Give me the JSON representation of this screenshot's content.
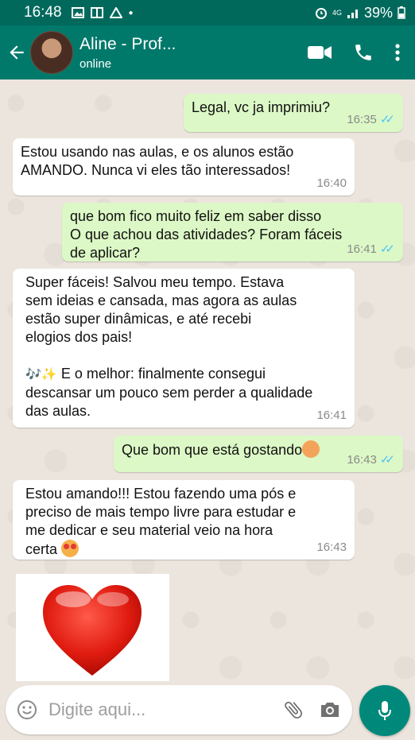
{
  "status": {
    "time": "16:48",
    "network": "4G",
    "battery": "39%"
  },
  "header": {
    "contact_name": "Aline - Prof...",
    "presence": "online"
  },
  "messages": [
    {
      "dir": "out",
      "text": "Legal, vc ja imprimiu?",
      "time": "16:35"
    },
    {
      "dir": "in",
      "lines": [
        "Estou usando nas aulas, e os alunos estão",
        "AMANDO. Nunca vi eles tão interessados!"
      ],
      "time": "16:40"
    },
    {
      "dir": "out",
      "lines": [
        "que bom fico muito feliz em saber disso",
        "O que achou das atividades? Foram fáceis",
        "de aplicar?"
      ],
      "time": "16:41"
    },
    {
      "dir": "in",
      "lines": [
        "Super fáceis! Salvou meu tempo. Estava",
        "sem ideias e cansada, mas agora as aulas",
        "estão super dinâmicas, e até recebi",
        "elogios dos pais!"
      ],
      "lines2_emoji": "🎶✨",
      "lines2": [
        " E o melhor: finalmente consegui",
        "descansar um pouco sem perder a qualidade",
        "das aulas."
      ],
      "time": "16:41"
    },
    {
      "dir": "out",
      "text": "Que bom que está gostando",
      "time": "16:43"
    },
    {
      "dir": "in",
      "lines": [
        "Estou amando!!! Estou fazendo uma pós e",
        "preciso de mais tempo livre para estudar e",
        "me dedicar e seu material veio na hora",
        "certa "
      ],
      "time": "16:43"
    }
  ],
  "composer": {
    "placeholder": "Digite aqui..."
  },
  "icons": {
    "back": "arrow-back-icon",
    "video": "video-call-icon",
    "call": "phone-icon",
    "menu": "more-vert-icon",
    "emoji": "emoji-icon",
    "attach": "paperclip-icon",
    "camera": "camera-icon",
    "mic": "microphone-icon"
  },
  "colors": {
    "header": "#00796b",
    "statusbar": "#00695c",
    "outgoing": "#dcf8c6",
    "incoming": "#ffffff",
    "ticks": "#4fc3f7",
    "accent": "#00897b"
  }
}
